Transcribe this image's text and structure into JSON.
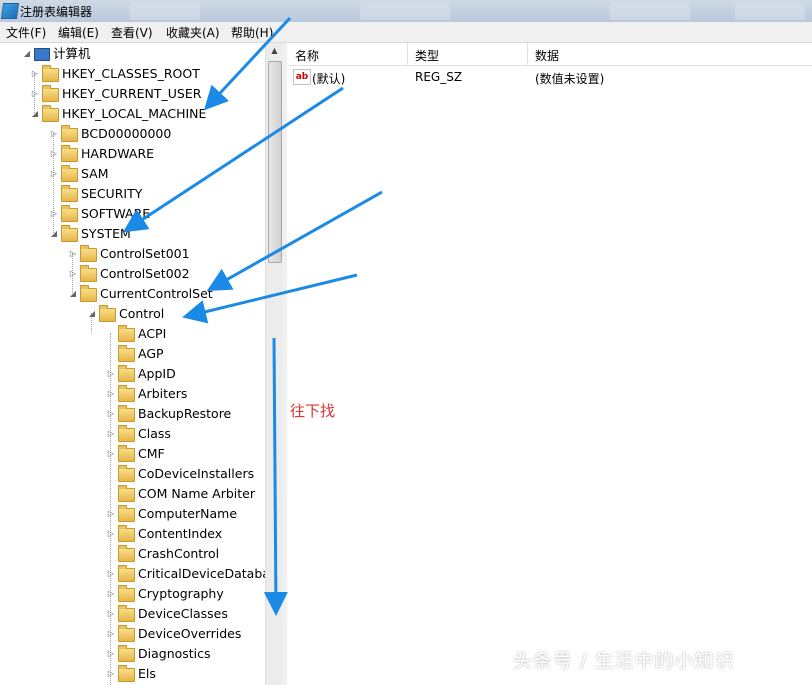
{
  "window": {
    "title": "注册表编辑器"
  },
  "menu": [
    "文件(F)",
    "编辑(E)",
    "查看(V)",
    "收藏夹(A)",
    "帮助(H)"
  ],
  "tree": [
    {
      "label": "计算机",
      "depth": 0,
      "expander": "expanded",
      "icon": "computer-icon"
    },
    {
      "label": "HKEY_CLASSES_ROOT",
      "depth": 1,
      "expander": "collapsed",
      "icon": "folder-icon"
    },
    {
      "label": "HKEY_CURRENT_USER",
      "depth": 1,
      "expander": "collapsed",
      "icon": "folder-icon"
    },
    {
      "label": "HKEY_LOCAL_MACHINE",
      "depth": 1,
      "expander": "expanded",
      "icon": "folder-icon"
    },
    {
      "label": "BCD00000000",
      "depth": 2,
      "expander": "collapsed",
      "icon": "folder-icon"
    },
    {
      "label": "HARDWARE",
      "depth": 2,
      "expander": "collapsed",
      "icon": "folder-icon"
    },
    {
      "label": "SAM",
      "depth": 2,
      "expander": "collapsed",
      "icon": "folder-icon"
    },
    {
      "label": "SECURITY",
      "depth": 2,
      "expander": "none",
      "icon": "folder-icon"
    },
    {
      "label": "SOFTWARE",
      "depth": 2,
      "expander": "collapsed",
      "icon": "folder-icon"
    },
    {
      "label": "SYSTEM",
      "depth": 2,
      "expander": "expanded",
      "icon": "folder-icon"
    },
    {
      "label": "ControlSet001",
      "depth": 3,
      "expander": "collapsed",
      "icon": "folder-icon"
    },
    {
      "label": "ControlSet002",
      "depth": 3,
      "expander": "collapsed",
      "icon": "folder-icon"
    },
    {
      "label": "CurrentControlSet",
      "depth": 3,
      "expander": "expanded",
      "icon": "folder-icon"
    },
    {
      "label": "Control",
      "depth": 4,
      "expander": "expanded",
      "icon": "folder-icon"
    },
    {
      "label": "ACPI",
      "depth": 5,
      "expander": "none",
      "icon": "folder-icon"
    },
    {
      "label": "AGP",
      "depth": 5,
      "expander": "none",
      "icon": "folder-icon"
    },
    {
      "label": "AppID",
      "depth": 5,
      "expander": "collapsed",
      "icon": "folder-icon"
    },
    {
      "label": "Arbiters",
      "depth": 5,
      "expander": "collapsed",
      "icon": "folder-icon"
    },
    {
      "label": "BackupRestore",
      "depth": 5,
      "expander": "collapsed",
      "icon": "folder-icon"
    },
    {
      "label": "Class",
      "depth": 5,
      "expander": "collapsed",
      "icon": "folder-icon"
    },
    {
      "label": "CMF",
      "depth": 5,
      "expander": "collapsed",
      "icon": "folder-icon"
    },
    {
      "label": "CoDeviceInstallers",
      "depth": 5,
      "expander": "none",
      "icon": "folder-icon"
    },
    {
      "label": "COM Name Arbiter",
      "depth": 5,
      "expander": "none",
      "icon": "folder-icon"
    },
    {
      "label": "ComputerName",
      "depth": 5,
      "expander": "collapsed",
      "icon": "folder-icon"
    },
    {
      "label": "ContentIndex",
      "depth": 5,
      "expander": "collapsed",
      "icon": "folder-icon"
    },
    {
      "label": "CrashControl",
      "depth": 5,
      "expander": "none",
      "icon": "folder-icon"
    },
    {
      "label": "CriticalDeviceDatabas",
      "depth": 5,
      "expander": "collapsed",
      "icon": "folder-icon"
    },
    {
      "label": "Cryptography",
      "depth": 5,
      "expander": "collapsed",
      "icon": "folder-icon"
    },
    {
      "label": "DeviceClasses",
      "depth": 5,
      "expander": "collapsed",
      "icon": "folder-icon"
    },
    {
      "label": "DeviceOverrides",
      "depth": 5,
      "expander": "collapsed",
      "icon": "folder-icon"
    },
    {
      "label": "Diagnostics",
      "depth": 5,
      "expander": "collapsed",
      "icon": "folder-icon"
    },
    {
      "label": "Els",
      "depth": 5,
      "expander": "collapsed",
      "icon": "folder-icon"
    }
  ],
  "list": {
    "headers": {
      "name": "名称",
      "type": "类型",
      "data": "数据"
    },
    "rows": [
      {
        "name": "(默认)",
        "type": "REG_SZ",
        "data": "(数值未设置)",
        "icon": "string-value-icon",
        "icon_text": "ab"
      }
    ]
  },
  "annotation": {
    "text": "往下找",
    "arrow_color": "#1a8ae6",
    "text_color": "#e0322f"
  },
  "watermark": "头条号 / 生活中的小知识"
}
